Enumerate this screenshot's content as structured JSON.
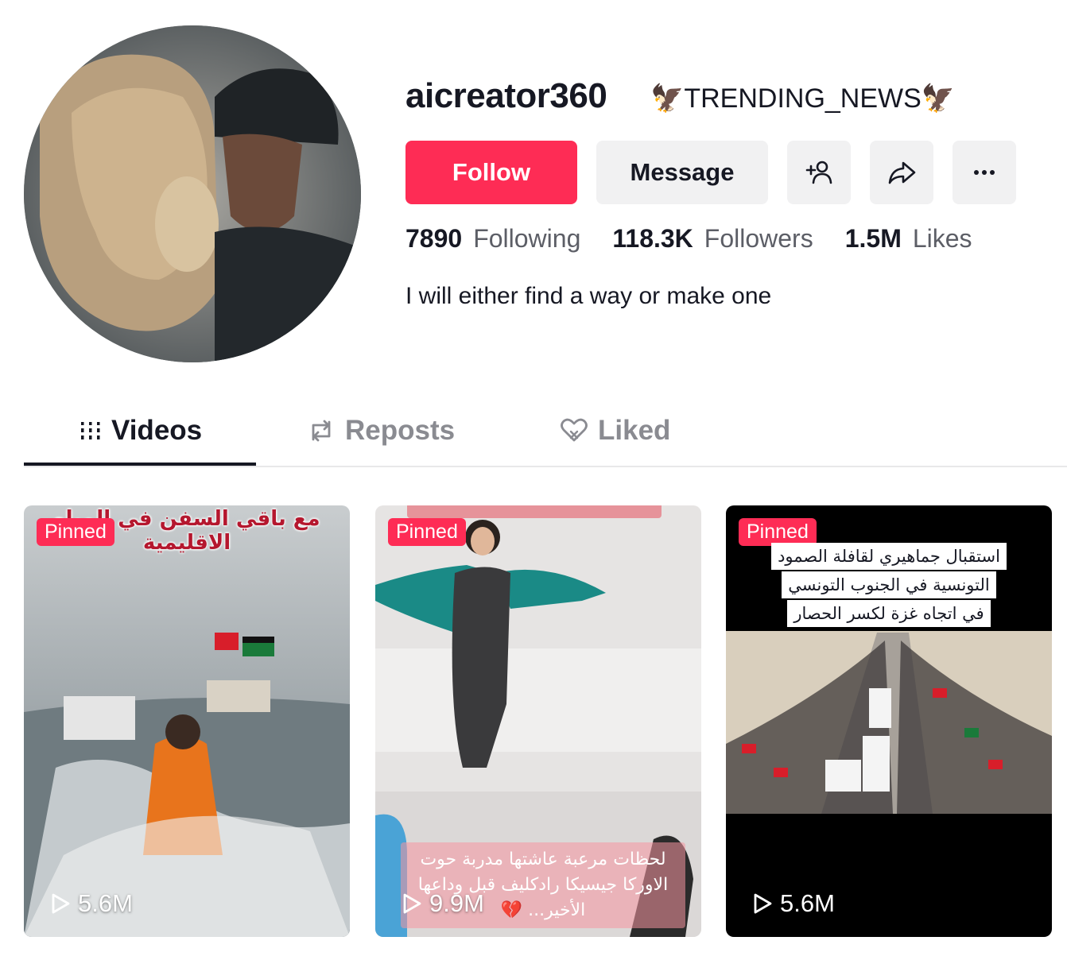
{
  "profile": {
    "username": "aicreator360",
    "nickname": "🦅TRENDING_NEWS🦅",
    "bio": "I will either find a way or make one",
    "avatar_icon": "profile-photo"
  },
  "actions": {
    "follow_label": "Follow",
    "message_label": "Message",
    "add_friend_icon": "add-user-icon",
    "share_icon": "share-icon",
    "more_icon": "more-icon"
  },
  "stats": {
    "following": {
      "value": "7890",
      "label": "Following"
    },
    "followers": {
      "value": "118.3K",
      "label": "Followers"
    },
    "likes": {
      "value": "1.5M",
      "label": "Likes"
    }
  },
  "tabs": [
    {
      "label": "Videos",
      "icon": "grid-icon",
      "active": true
    },
    {
      "label": "Reposts",
      "icon": "repost-icon",
      "active": false
    },
    {
      "label": "Liked",
      "icon": "heart-icon",
      "active": false
    }
  ],
  "videos": [
    {
      "badge": "Pinned",
      "views": "5.6M",
      "caption": "مع باقي السفن في المياه الاقليمية"
    },
    {
      "badge": "Pinned",
      "views": "9.9M",
      "caption": "لحظات مرعبة عاشتها مدربة حوت الاوركا جيسيكا رادكليف قبل وداعها الأخير... 💔"
    },
    {
      "badge": "Pinned",
      "views": "5.6M",
      "caption": [
        "استقبال جماهيري لقافلة الصمود",
        "التونسية في الجنوب التونسي",
        "في اتجاه غزة لكسر الحصار"
      ]
    }
  ],
  "colors": {
    "accent": "#fe2c55",
    "text": "#161823",
    "muted": "#8a8b91",
    "button_bg": "#f1f1f2"
  }
}
